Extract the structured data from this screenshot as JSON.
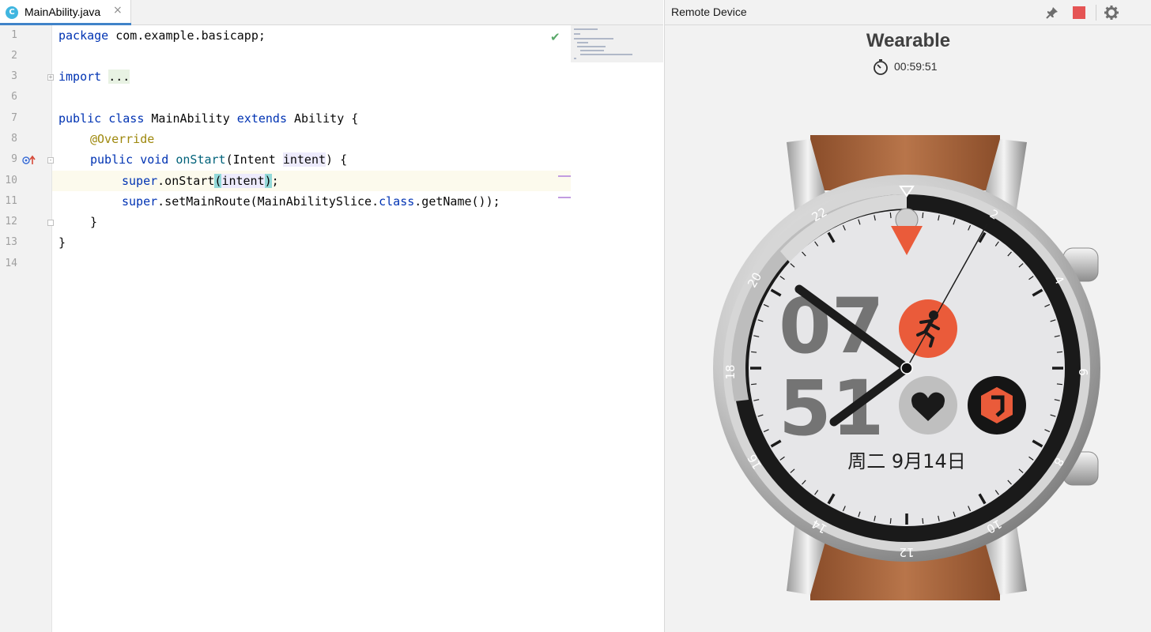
{
  "tab": {
    "icon_letter": "C",
    "label": "MainAbility.java",
    "close": "×"
  },
  "editor": {
    "line_numbers": [
      "1",
      "2",
      "3",
      "6",
      "7",
      "8",
      "9",
      "10",
      "11",
      "12",
      "13",
      "14"
    ],
    "lines": {
      "l1": {
        "kw": "package",
        "rest": " com.example.basicapp;"
      },
      "l3": {
        "kw": "import",
        "sp": " ",
        "fold": "..."
      },
      "l7": {
        "kw1": "public",
        "sp1": " ",
        "kw2": "class",
        "name": " MainAbility ",
        "kw3": "extends",
        "rest": " Ability {"
      },
      "l8": {
        "ann": "@Override"
      },
      "l9": {
        "kw1": "public",
        "sp1": " ",
        "kw2": "void",
        "sp2": " ",
        "fn": "onStart",
        "a": "(Intent ",
        "param": "intent",
        "b": ") {"
      },
      "l10": {
        "kw": "super",
        "a": ".onStart",
        "lp": "(",
        "param": "intent",
        "rp": ")",
        "b": ";"
      },
      "l11": {
        "kw": "super",
        "a": ".setMainRoute(MainAbilitySlice.",
        "kw2": "class",
        "b": ".getName());"
      },
      "l12": {
        "text": "}"
      },
      "l13": {
        "text": "}"
      }
    },
    "status_icon": "check-icon"
  },
  "device_panel": {
    "title": "Remote Device",
    "device_name": "Wearable",
    "timer": "00:59:51",
    "icons": [
      "pin-icon",
      "stop-icon",
      "gear-icon"
    ]
  },
  "watch_face": {
    "hour_digits": "07",
    "minute_digits": "51",
    "date": "周二 9月14日",
    "bezel_labels": [
      "2",
      "4",
      "6",
      "8",
      "10",
      "12",
      "14",
      "16",
      "18",
      "20",
      "22"
    ],
    "colors": {
      "accent": "#ea5b3a",
      "strap": "#b06a3e",
      "bezel": "#1a1a1a"
    }
  }
}
